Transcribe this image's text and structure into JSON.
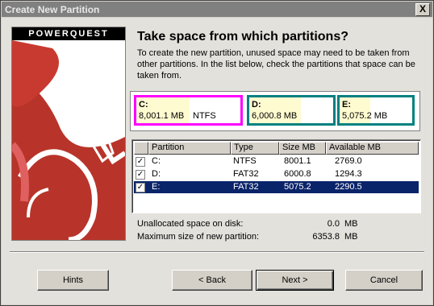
{
  "window": {
    "title": "Create New Partition",
    "close_label": "X"
  },
  "logo": {
    "brand": "POWERQUEST"
  },
  "header": {
    "heading": "Take space from which partitions?",
    "description": "To create the new partition, unused space may need to be taken from other partitions. In the list below, check the partitions that space can be taken from."
  },
  "partitions_map": [
    {
      "label": "C:",
      "size": "8,001.1 MB",
      "fs": "NTFS",
      "border_color": "#ff00ff"
    },
    {
      "label": "D:",
      "size": "6,000.8 MB",
      "fs": "",
      "border_color": "#008080"
    },
    {
      "label": "E:",
      "size": "5,075.2 MB",
      "fs": "",
      "border_color": "#008080"
    }
  ],
  "table": {
    "columns": [
      "Partition",
      "Type",
      "Size MB",
      "Available MB"
    ],
    "rows": [
      {
        "checked": true,
        "partition": "C:",
        "type": "NTFS",
        "size": "8001.1",
        "available": "2769.0"
      },
      {
        "checked": true,
        "partition": "D:",
        "type": "FAT32",
        "size": "6000.8",
        "available": "1294.3"
      },
      {
        "checked": true,
        "partition": "E:",
        "type": "FAT32",
        "size": "5075.2",
        "available": "2290.5",
        "selected": true
      }
    ]
  },
  "summary": {
    "unallocated_label": "Unallocated space on disk:",
    "unallocated_value": "0.0",
    "max_label": "Maximum size of new partition:",
    "max_value": "6353.8",
    "unit": "MB"
  },
  "buttons": {
    "hints": "Hints",
    "back": "< Back",
    "next": "Next >",
    "cancel": "Cancel"
  },
  "colors": {
    "selection": "#0a246a",
    "c_border": "#ff00ff",
    "de_border": "#008080"
  }
}
